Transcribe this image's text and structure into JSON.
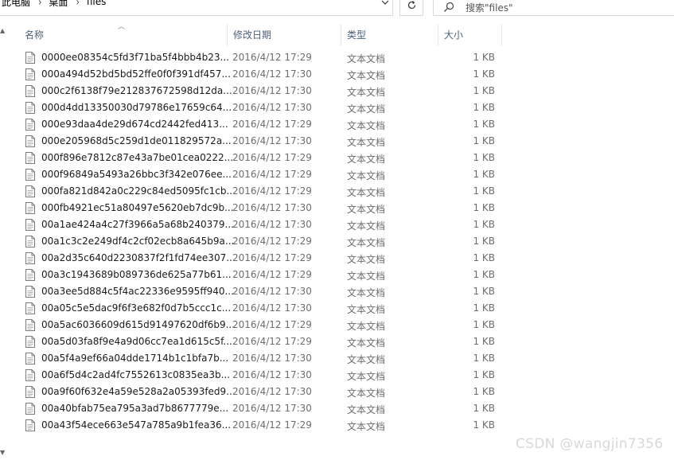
{
  "breadcrumb": {
    "items": [
      "此电脑",
      "桌面",
      "files"
    ]
  },
  "search": {
    "placeholder": "搜索\"files\""
  },
  "columns": {
    "name": "名称",
    "date": "修改日期",
    "type": "类型",
    "size": "大小"
  },
  "files": [
    {
      "name": "0000ee08354c5fd3f71ba5f4bbb4b23...",
      "date": "2016/4/12 17:29",
      "type": "文本文档",
      "size": "1 KB"
    },
    {
      "name": "000a494d52bd5bd52ffe0f0f391df457...",
      "date": "2016/4/12 17:30",
      "type": "文本文档",
      "size": "1 KB"
    },
    {
      "name": "000c2f6138f79e212837672598d12da...",
      "date": "2016/4/12 17:30",
      "type": "文本文档",
      "size": "1 KB"
    },
    {
      "name": "000d4dd13350030d79786e17659c64...",
      "date": "2016/4/12 17:30",
      "type": "文本文档",
      "size": "1 KB"
    },
    {
      "name": "000e93daa4de29d674cd2442fed413...",
      "date": "2016/4/12 17:29",
      "type": "文本文档",
      "size": "1 KB"
    },
    {
      "name": "000e205968d5c259d1de011829572a...",
      "date": "2016/4/12 17:30",
      "type": "文本文档",
      "size": "1 KB"
    },
    {
      "name": "000f896e7812c87e43a7be01cea0222...",
      "date": "2016/4/12 17:29",
      "type": "文本文档",
      "size": "1 KB"
    },
    {
      "name": "000f96849a5493a26bbc3f342e076ee...",
      "date": "2016/4/12 17:29",
      "type": "文本文档",
      "size": "1 KB"
    },
    {
      "name": "000fa821d842a0c229c84ed5095fc1cb...",
      "date": "2016/4/12 17:29",
      "type": "文本文档",
      "size": "1 KB"
    },
    {
      "name": "000fb4921ec51a80497e5620eb7dc9b...",
      "date": "2016/4/12 17:30",
      "type": "文本文档",
      "size": "1 KB"
    },
    {
      "name": "00a1ae424a4c27f3966a5a68b240379...",
      "date": "2016/4/12 17:30",
      "type": "文本文档",
      "size": "1 KB"
    },
    {
      "name": "00a1c3c2e249df4c2cf02ecb8a645b9a...",
      "date": "2016/4/12 17:29",
      "type": "文本文档",
      "size": "1 KB"
    },
    {
      "name": "00a2d35c640d2230837f2f1fd74ee307...",
      "date": "2016/4/12 17:29",
      "type": "文本文档",
      "size": "1 KB"
    },
    {
      "name": "00a3c1943689b089736de625a77b61...",
      "date": "2016/4/12 17:29",
      "type": "文本文档",
      "size": "1 KB"
    },
    {
      "name": "00a3ee5d884c5f4ac22336e9595ff940...",
      "date": "2016/4/12 17:30",
      "type": "文本文档",
      "size": "1 KB"
    },
    {
      "name": "00a05c5e5dac9f6f3e682f0d7b5ccc1c...",
      "date": "2016/4/12 17:30",
      "type": "文本文档",
      "size": "1 KB"
    },
    {
      "name": "00a5ac6036609d615d91497620df6b9...",
      "date": "2016/4/12 17:29",
      "type": "文本文档",
      "size": "1 KB"
    },
    {
      "name": "00a5d03fa8f9e4a9d06cc7ea1d615c5f...",
      "date": "2016/4/12 17:29",
      "type": "文本文档",
      "size": "1 KB"
    },
    {
      "name": "00a5f4a9ef66a04dde1714b1c1bfa7b...",
      "date": "2016/4/12 17:30",
      "type": "文本文档",
      "size": "1 KB"
    },
    {
      "name": "00a6f5d4c2ad4fc7552613c0835ea3b...",
      "date": "2016/4/12 17:30",
      "type": "文本文档",
      "size": "1 KB"
    },
    {
      "name": "00a9f60f632e4a59e528a2a05393fed9...",
      "date": "2016/4/12 17:30",
      "type": "文本文档",
      "size": "1 KB"
    },
    {
      "name": "00a40bfab75ea795a3ad7b8677779e...",
      "date": "2016/4/12 17:30",
      "type": "文本文档",
      "size": "1 KB"
    },
    {
      "name": "00a43f54ece663e547a785a9b1fea36...",
      "date": "2016/4/12 17:29",
      "type": "文本文档",
      "size": "1 KB"
    }
  ],
  "watermark": "CSDN @wangjin7356"
}
